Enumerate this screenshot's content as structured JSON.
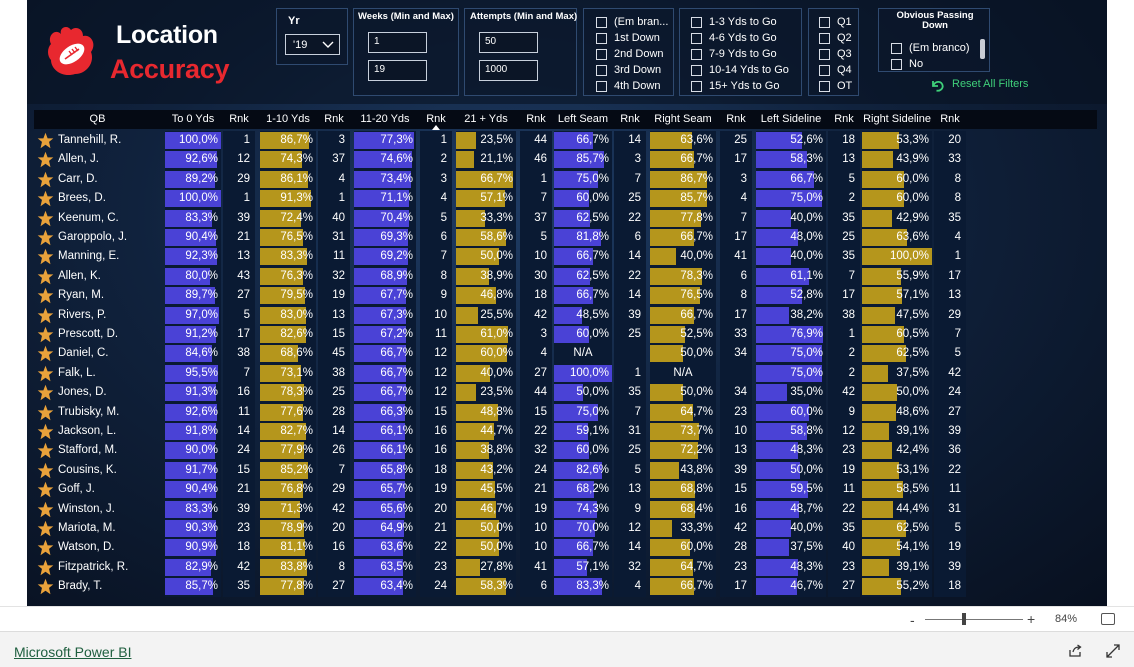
{
  "title": {
    "line1": "Location",
    "line2": "Accuracy"
  },
  "slicers": {
    "year": {
      "title": "Yr",
      "value": "'19"
    },
    "weeks": {
      "title": "Weeks (Min and Max)",
      "min": "1",
      "max": "19"
    },
    "attempts": {
      "title": "Attempts (Min and Max)",
      "min": "50",
      "max": "1000"
    },
    "downs": [
      "(Em bran...",
      "1st Down",
      "2nd Down",
      "3rd Down",
      "4th Down"
    ],
    "yards": [
      "1-3 Yds to Go",
      "4-6 Yds to Go",
      "7-9 Yds to Go",
      "10-14 Yds to Go",
      "15+ Yds to Go"
    ],
    "quarters": [
      "Q1",
      "Q2",
      "Q3",
      "Q4",
      "OT"
    ],
    "obvious": {
      "title": "Obvious Passing Down",
      "options": [
        "(Em branco)",
        "No"
      ]
    }
  },
  "reset_label": "Reset All Filters",
  "colors": {
    "blue_bar": "#4a42d6",
    "gold_bar": "#b5961c",
    "brand_red": "#e8282f",
    "reset_green": "#3fd07a"
  },
  "table": {
    "headers": [
      "QB",
      "To 0 Yds",
      "Rnk",
      "1-10 Yds",
      "Rnk",
      "11-20 Yds",
      "Rnk",
      "21 + Yds",
      "Rnk",
      "Left Seam",
      "Rnk",
      "Right Seam",
      "Rnk",
      "Left Sideline",
      "Rnk",
      "Right Sideline",
      "Rnk"
    ],
    "rows": [
      [
        "Tannehill, R.",
        "100,0%",
        "1",
        "86,7%",
        "3",
        "77,3%",
        "1",
        "23,5%",
        "44",
        "66,7%",
        "14",
        "63,6%",
        "25",
        "52,6%",
        "18",
        "53,3%",
        "20"
      ],
      [
        "Allen, J.",
        "92,6%",
        "12",
        "74,3%",
        "37",
        "74,6%",
        "2",
        "21,1%",
        "46",
        "85,7%",
        "3",
        "66,7%",
        "17",
        "58,3%",
        "13",
        "43,9%",
        "33"
      ],
      [
        "Carr, D.",
        "89,2%",
        "29",
        "86,1%",
        "4",
        "73,4%",
        "3",
        "66,7%",
        "1",
        "75,0%",
        "7",
        "86,7%",
        "3",
        "66,7%",
        "5",
        "60,0%",
        "8"
      ],
      [
        "Brees, D.",
        "100,0%",
        "1",
        "91,3%",
        "1",
        "71,1%",
        "4",
        "57,1%",
        "7",
        "60,0%",
        "25",
        "85,7%",
        "4",
        "75,0%",
        "2",
        "60,0%",
        "8"
      ],
      [
        "Keenum, C.",
        "83,3%",
        "39",
        "72,4%",
        "40",
        "70,4%",
        "5",
        "33,3%",
        "37",
        "62,5%",
        "22",
        "77,8%",
        "7",
        "40,0%",
        "35",
        "42,9%",
        "35"
      ],
      [
        "Garoppolo, J.",
        "90,4%",
        "21",
        "76,5%",
        "31",
        "69,3%",
        "6",
        "58,6%",
        "5",
        "81,8%",
        "6",
        "66,7%",
        "17",
        "48,0%",
        "25",
        "63,6%",
        "4"
      ],
      [
        "Manning, E.",
        "92,3%",
        "13",
        "83,3%",
        "11",
        "69,2%",
        "7",
        "50,0%",
        "10",
        "66,7%",
        "14",
        "40,0%",
        "41",
        "40,0%",
        "35",
        "100,0%",
        "1"
      ],
      [
        "Allen, K.",
        "80,0%",
        "43",
        "76,3%",
        "32",
        "68,9%",
        "8",
        "38,9%",
        "30",
        "62,5%",
        "22",
        "78,3%",
        "6",
        "61,1%",
        "7",
        "55,9%",
        "17"
      ],
      [
        "Ryan, M.",
        "89,7%",
        "27",
        "79,5%",
        "19",
        "67,7%",
        "9",
        "46,8%",
        "18",
        "66,7%",
        "14",
        "76,5%",
        "8",
        "52,8%",
        "17",
        "57,1%",
        "13"
      ],
      [
        "Rivers, P.",
        "97,0%",
        "5",
        "83,0%",
        "13",
        "67,3%",
        "10",
        "25,5%",
        "42",
        "48,5%",
        "39",
        "66,7%",
        "17",
        "38,2%",
        "38",
        "47,5%",
        "29"
      ],
      [
        "Prescott, D.",
        "91,2%",
        "17",
        "82,6%",
        "15",
        "67,2%",
        "11",
        "61,0%",
        "3",
        "60,0%",
        "25",
        "52,5%",
        "33",
        "76,9%",
        "1",
        "60,5%",
        "7"
      ],
      [
        "Daniel, C.",
        "84,6%",
        "38",
        "68,6%",
        "45",
        "66,7%",
        "12",
        "60,0%",
        "4",
        "N/A",
        "",
        "50,0%",
        "34",
        "75,0%",
        "2",
        "62,5%",
        "5"
      ],
      [
        "Falk, L.",
        "95,5%",
        "7",
        "73,1%",
        "38",
        "66,7%",
        "12",
        "40,0%",
        "27",
        "100,0%",
        "1",
        "N/A",
        "",
        "75,0%",
        "2",
        "37,5%",
        "42"
      ],
      [
        "Jones, D.",
        "91,3%",
        "16",
        "78,3%",
        "25",
        "66,7%",
        "12",
        "23,5%",
        "44",
        "50,0%",
        "35",
        "50,0%",
        "34",
        "35,0%",
        "42",
        "50,0%",
        "24"
      ],
      [
        "Trubisky, M.",
        "92,6%",
        "11",
        "77,6%",
        "28",
        "66,3%",
        "15",
        "48,8%",
        "15",
        "75,0%",
        "7",
        "64,7%",
        "23",
        "60,0%",
        "9",
        "48,6%",
        "27"
      ],
      [
        "Jackson, L.",
        "91,8%",
        "14",
        "82,7%",
        "14",
        "66,1%",
        "16",
        "44,7%",
        "22",
        "59,1%",
        "31",
        "73,7%",
        "10",
        "58,8%",
        "12",
        "39,1%",
        "39"
      ],
      [
        "Stafford, M.",
        "90,0%",
        "24",
        "77,9%",
        "26",
        "66,1%",
        "16",
        "38,8%",
        "32",
        "60,0%",
        "25",
        "72,2%",
        "13",
        "48,3%",
        "23",
        "42,4%",
        "36"
      ],
      [
        "Cousins, K.",
        "91,7%",
        "15",
        "85,2%",
        "7",
        "65,8%",
        "18",
        "43,2%",
        "24",
        "82,6%",
        "5",
        "43,8%",
        "39",
        "50,0%",
        "19",
        "53,1%",
        "22"
      ],
      [
        "Goff, J.",
        "90,4%",
        "21",
        "76,8%",
        "29",
        "65,7%",
        "19",
        "45,5%",
        "21",
        "68,2%",
        "13",
        "68,8%",
        "15",
        "59,5%",
        "11",
        "58,5%",
        "11"
      ],
      [
        "Winston, J.",
        "83,3%",
        "39",
        "71,3%",
        "42",
        "65,6%",
        "20",
        "46,7%",
        "19",
        "74,3%",
        "9",
        "68,4%",
        "16",
        "48,7%",
        "22",
        "44,4%",
        "31"
      ],
      [
        "Mariota, M.",
        "90,3%",
        "23",
        "78,9%",
        "20",
        "64,9%",
        "21",
        "50,0%",
        "10",
        "70,0%",
        "12",
        "33,3%",
        "42",
        "40,0%",
        "35",
        "62,5%",
        "5"
      ],
      [
        "Watson, D.",
        "90,9%",
        "18",
        "81,1%",
        "16",
        "63,6%",
        "22",
        "50,0%",
        "10",
        "66,7%",
        "14",
        "60,0%",
        "28",
        "37,5%",
        "40",
        "54,1%",
        "19"
      ],
      [
        "Fitzpatrick, R.",
        "82,9%",
        "42",
        "83,8%",
        "8",
        "63,5%",
        "23",
        "27,8%",
        "41",
        "57,1%",
        "32",
        "64,7%",
        "23",
        "48,3%",
        "23",
        "39,1%",
        "39"
      ],
      [
        "Brady, T.",
        "85,7%",
        "35",
        "77,8%",
        "27",
        "63,4%",
        "24",
        "58,3%",
        "6",
        "83,3%",
        "4",
        "66,7%",
        "17",
        "46,7%",
        "27",
        "55,2%",
        "18"
      ]
    ]
  },
  "footer": {
    "link": "Microsoft Power BI",
    "zoom_minus": "-",
    "zoom_plus": "+",
    "zoom_level": "84%"
  }
}
